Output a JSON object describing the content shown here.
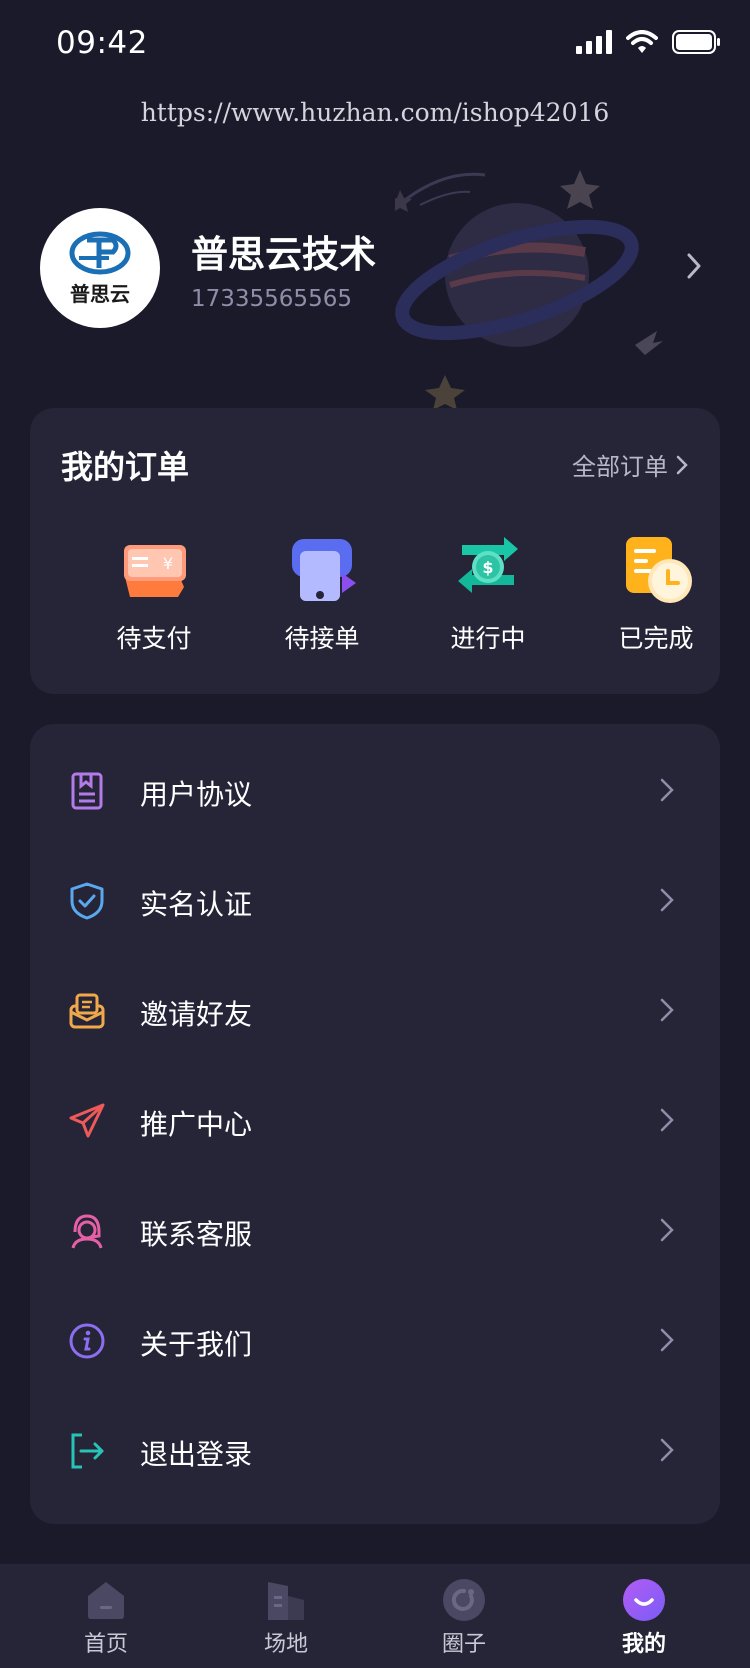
{
  "status_bar": {
    "time": "09:42"
  },
  "watermark": "https://www.huzhan.com/ishop42016",
  "profile": {
    "avatar_text": "普思云",
    "name": "普思云技术",
    "phone": "17335565565"
  },
  "orders": {
    "title": "我的订单",
    "all_label": "全部订单",
    "items": [
      {
        "label": "待支付",
        "icon": "pending-payment-icon"
      },
      {
        "label": "待接单",
        "icon": "pending-accept-icon"
      },
      {
        "label": "进行中",
        "icon": "in-progress-icon"
      },
      {
        "label": "已完成",
        "icon": "completed-icon"
      }
    ]
  },
  "menu": [
    {
      "label": "用户协议",
      "icon": "document-icon",
      "color": "#b37be8"
    },
    {
      "label": "实名认证",
      "icon": "shield-check-icon",
      "color": "#5aa9ee"
    },
    {
      "label": "邀请好友",
      "icon": "envelope-icon",
      "color": "#f0a84a"
    },
    {
      "label": "推广中心",
      "icon": "paper-plane-icon",
      "color": "#ee5a5a"
    },
    {
      "label": "联系客服",
      "icon": "headset-icon",
      "color": "#e660a8"
    },
    {
      "label": "关于我们",
      "icon": "info-icon",
      "color": "#8d6ef0"
    },
    {
      "label": "退出登录",
      "icon": "logout-icon",
      "color": "#27c4b5"
    }
  ],
  "tabs": [
    {
      "label": "首页",
      "icon": "home-icon",
      "active": false
    },
    {
      "label": "场地",
      "icon": "venue-icon",
      "active": false
    },
    {
      "label": "圈子",
      "icon": "circle-icon",
      "active": false
    },
    {
      "label": "我的",
      "icon": "smile-icon",
      "active": true
    }
  ],
  "colors": {
    "background": "#1b1a2b",
    "card": "#262538",
    "accent": "#8e5cf6",
    "muted_text": "#8f8ea8"
  }
}
